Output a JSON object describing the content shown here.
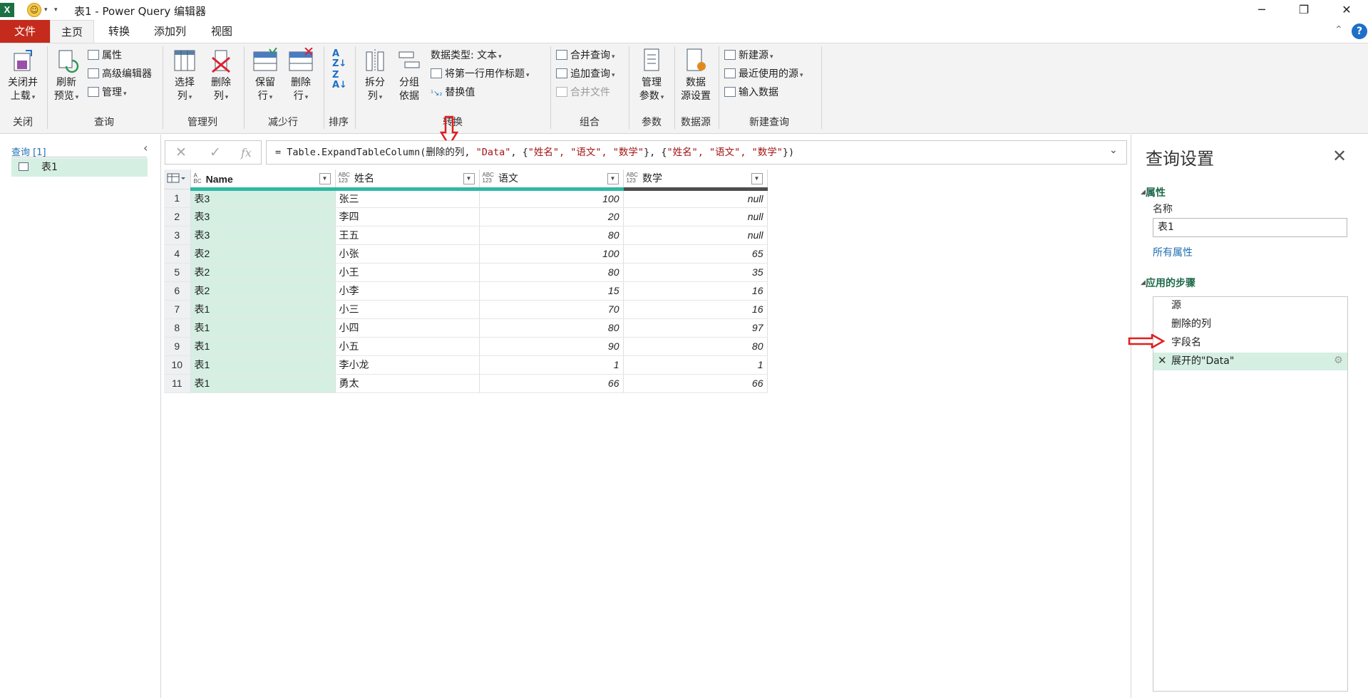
{
  "app": {
    "title": "表1 - Power Query 编辑器",
    "logo_letter": "X"
  },
  "tabs": [
    {
      "label": "文件"
    },
    {
      "label": "主页"
    },
    {
      "label": "转换"
    },
    {
      "label": "添加列"
    },
    {
      "label": "视图"
    }
  ],
  "ribbon": {
    "close": {
      "btn1": "关闭并",
      "btn2": "上载",
      "group": "关闭"
    },
    "query": {
      "refresh1": "刷新",
      "refresh2": "预览",
      "properties": "属性",
      "advanced_editor": "高级编辑器",
      "manage": "管理",
      "group": "查询"
    },
    "manage_cols": {
      "choose1": "选择",
      "choose2": "列",
      "remove1": "删除",
      "remove2": "列",
      "group": "管理列"
    },
    "reduce_rows": {
      "keep1": "保留",
      "keep2": "行",
      "remove1": "删除",
      "remove2": "行",
      "group": "减少行"
    },
    "sort": {
      "group": "排序"
    },
    "transform": {
      "split1": "拆分",
      "split2": "列",
      "groupby1": "分组",
      "groupby2": "依据",
      "datatype": "数据类型: 文本",
      "first_row_header": "将第一行用作标题",
      "replace_values": "替换值",
      "group": "转换"
    },
    "combine": {
      "merge": "合并查询",
      "append": "追加查询",
      "combine_files": "合并文件",
      "group": "组合"
    },
    "params": {
      "btn1": "管理",
      "btn2": "参数",
      "group": "参数"
    },
    "datasource": {
      "btn1": "数据",
      "btn2": "源设置",
      "group": "数据源"
    },
    "newquery": {
      "new_source": "新建源",
      "recent_sources": "最近使用的源",
      "enter_data": "输入数据",
      "group": "新建查询"
    }
  },
  "queries": {
    "header": "查询 [1]",
    "items": [
      {
        "label": "表1"
      }
    ]
  },
  "formula": {
    "prefix": "= Table.ExpandTableColumn(删除的列, ",
    "data_str": "\"Data\"",
    "mid1": ", {",
    "list1": "\"姓名\", \"语文\", \"数学\"",
    "mid2": "}, {",
    "list2": "\"姓名\", \"语文\", \"数学\"",
    "suffix": "})"
  },
  "grid": {
    "columns": [
      {
        "label": "Name",
        "type_top": "A",
        "type_bottom": "BC"
      },
      {
        "label": "姓名",
        "type_top": "ABC",
        "type_bottom": "123"
      },
      {
        "label": "语文",
        "type_top": "ABC",
        "type_bottom": "123"
      },
      {
        "label": "数学",
        "type_top": "ABC",
        "type_bottom": "123"
      }
    ],
    "rows": [
      {
        "n": "1",
        "name": "表3",
        "xm": "张三",
        "yw": "100",
        "sx": "null"
      },
      {
        "n": "2",
        "name": "表3",
        "xm": "李四",
        "yw": "20",
        "sx": "null"
      },
      {
        "n": "3",
        "name": "表3",
        "xm": "王五",
        "yw": "80",
        "sx": "null"
      },
      {
        "n": "4",
        "name": "表2",
        "xm": "小张",
        "yw": "100",
        "sx": "65"
      },
      {
        "n": "5",
        "name": "表2",
        "xm": "小王",
        "yw": "80",
        "sx": "35"
      },
      {
        "n": "6",
        "name": "表2",
        "xm": "小李",
        "yw": "15",
        "sx": "16"
      },
      {
        "n": "7",
        "name": "表1",
        "xm": "小三",
        "yw": "70",
        "sx": "16"
      },
      {
        "n": "8",
        "name": "表1",
        "xm": "小四",
        "yw": "80",
        "sx": "97"
      },
      {
        "n": "9",
        "name": "表1",
        "xm": "小五",
        "yw": "90",
        "sx": "80"
      },
      {
        "n": "10",
        "name": "表1",
        "xm": "李小龙",
        "yw": "1",
        "sx": "1"
      },
      {
        "n": "11",
        "name": "表1",
        "xm": "勇太",
        "yw": "66",
        "sx": "66"
      }
    ]
  },
  "settings": {
    "title": "查询设置",
    "properties_header": "属性",
    "name_label": "名称",
    "name_value": "表1",
    "all_properties": "所有属性",
    "steps_header": "应用的步骤",
    "steps": [
      {
        "label": "源"
      },
      {
        "label": "删除的列"
      },
      {
        "label": "字段名"
      },
      {
        "label": "展开的\"Data\""
      }
    ]
  },
  "colors": {
    "file_tab": "#c42b1c",
    "selection_green": "#d5efe3",
    "column_quality_bar": "#2fb8a4",
    "annotation_red": "#e01e1e"
  }
}
